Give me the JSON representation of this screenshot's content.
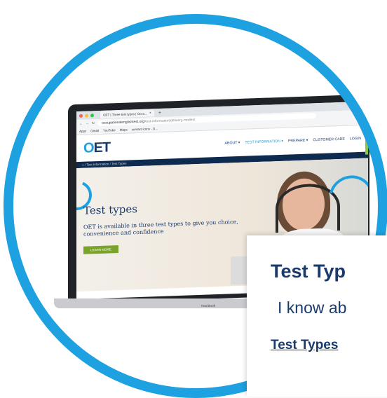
{
  "browser": {
    "tab_title": "OET | Three test types | Occu...",
    "tab_close": "×",
    "new_tab": "+",
    "address": "occupationalenglishtest.org",
    "address_path": "/test-information/delivery-modes/",
    "bookmarks": [
      "Apps",
      "Gmail",
      "YouTube",
      "Maps",
      "contact icons - G..."
    ]
  },
  "site": {
    "logo_o": "O",
    "logo_rest": "ET",
    "nav": [
      "ABOUT ▾",
      "TEST INFORMATION ▾",
      "PREPARE ▾",
      "CUSTOMER CARE",
      "LOGIN"
    ],
    "breadcrumb": "⌂ / Test Information / Test Types",
    "hero_title": "Test types",
    "hero_text": "OET is available in three test types to give you choice, convenience and confidence",
    "learn_more": "LEARN MORE"
  },
  "laptop": {
    "brand": "macbook"
  },
  "card": {
    "title": "Test Typ",
    "text": "I know ab",
    "link": "Test Types"
  },
  "colors": {
    "accent": "#1ea1e0",
    "navy": "#1a3a6b",
    "green": "#7aa329"
  }
}
